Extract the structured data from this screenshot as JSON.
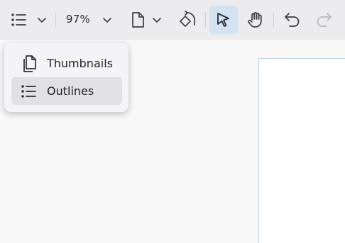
{
  "toolbar": {
    "sidebar_toggle": {
      "icon": "list-icon",
      "dropdown_icon": "chevron-down-icon"
    },
    "zoom": {
      "value": "97%",
      "dropdown_icon": "chevron-down-icon"
    },
    "page_view": {
      "icon": "document-icon",
      "dropdown_icon": "chevron-down-icon"
    },
    "rotate": {
      "icon": "rotate-icon"
    },
    "select_tool": {
      "icon": "cursor-icon",
      "active": true
    },
    "pan_tool": {
      "icon": "hand-icon"
    },
    "undo": {
      "icon": "undo-icon"
    },
    "redo": {
      "icon": "redo-icon",
      "enabled": false
    }
  },
  "sidebar_menu": {
    "items": [
      {
        "label": "Thumbnails",
        "icon": "thumbnails-icon",
        "selected": false
      },
      {
        "label": "Outlines",
        "icon": "list-icon",
        "selected": true
      }
    ]
  },
  "colors": {
    "toolbar_bg": "#ececef",
    "active_tool_bg": "#d3e3f1",
    "menu_selected_bg": "#e1e1e4",
    "page_border": "#b9d2e8"
  }
}
